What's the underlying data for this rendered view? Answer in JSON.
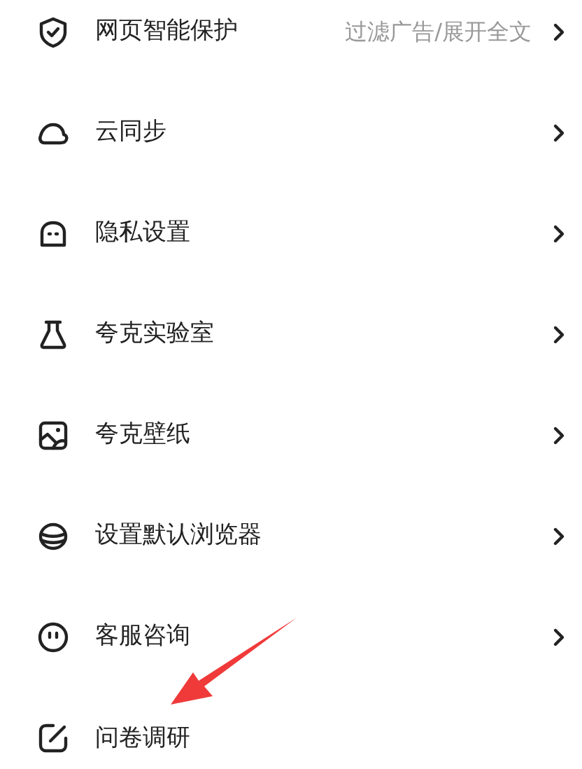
{
  "settings_items": [
    {
      "label": "网页智能保护",
      "value": "过滤广告/展开全文",
      "chevron": true
    },
    {
      "label": "云同步",
      "chevron": true
    },
    {
      "label": "隐私设置",
      "chevron": true
    },
    {
      "label": "夸克实验室",
      "chevron": true
    },
    {
      "label": "夸克壁纸",
      "chevron": true
    },
    {
      "label": "设置默认浏览器",
      "chevron": true
    },
    {
      "label": "客服咨询",
      "chevron": true
    },
    {
      "label": "问卷调研",
      "chevron": false
    }
  ]
}
